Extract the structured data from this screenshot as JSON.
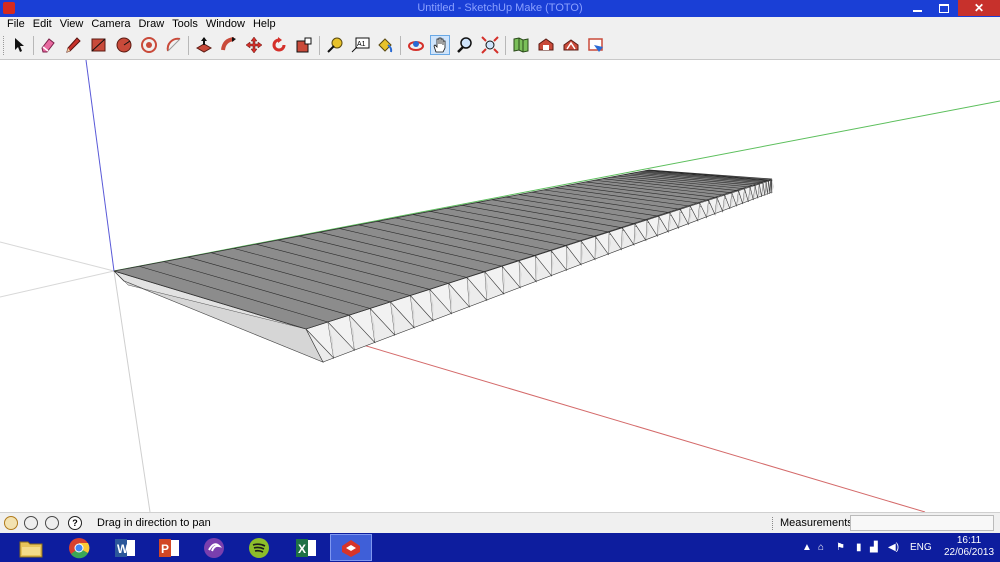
{
  "window": {
    "title": "Untitled - SketchUp Make (TOTO)",
    "close_glyph": "✕"
  },
  "menu": [
    "File",
    "Edit",
    "View",
    "Camera",
    "Draw",
    "Tools",
    "Window",
    "Help"
  ],
  "toolbar": {
    "tools": [
      {
        "name": "select-tool",
        "icon": "arrow-cursor-icon"
      },
      {
        "name": "eraser-tool",
        "icon": "eraser-icon"
      },
      {
        "name": "line-tool",
        "icon": "pencil-icon"
      },
      {
        "name": "rectangle-tool",
        "icon": "rectangle-icon"
      },
      {
        "name": "circle-tool",
        "icon": "circle-icon"
      },
      {
        "name": "polygon-tool",
        "icon": "polygon-icon"
      },
      {
        "name": "arc-tool",
        "icon": "arc-icon"
      },
      {
        "name": "push-pull-tool",
        "icon": "push-pull-icon"
      },
      {
        "name": "follow-me-tool",
        "icon": "follow-me-icon"
      },
      {
        "name": "move-tool",
        "icon": "move-icon"
      },
      {
        "name": "rotate-tool",
        "icon": "rotate-icon"
      },
      {
        "name": "scale-tool",
        "icon": "scale-icon"
      },
      {
        "name": "tape-measure-tool",
        "icon": "tape-measure-icon"
      },
      {
        "name": "text-tool",
        "icon": "text-icon",
        "label": "A1"
      },
      {
        "name": "paint-bucket-tool",
        "icon": "paint-bucket-icon"
      },
      {
        "name": "orbit-tool",
        "icon": "orbit-icon"
      },
      {
        "name": "pan-tool",
        "icon": "hand-icon",
        "active": true
      },
      {
        "name": "zoom-tool",
        "icon": "magnifier-icon"
      },
      {
        "name": "zoom-extents-tool",
        "icon": "zoom-extents-icon"
      },
      {
        "name": "add-location-tool",
        "icon": "map-icon"
      },
      {
        "name": "3d-warehouse-tool",
        "icon": "warehouse-icon"
      },
      {
        "name": "share-model-tool",
        "icon": "share-icon"
      },
      {
        "name": "extension-warehouse-tool",
        "icon": "extension-icon"
      }
    ]
  },
  "status": {
    "message": "Drag in direction to pan",
    "measurements_label": "Measurements",
    "measurements_value": "",
    "help_glyph": "?"
  },
  "taskbar": {
    "apps": [
      {
        "name": "file-explorer",
        "icon": "folder-icon"
      },
      {
        "name": "chrome",
        "icon": "chrome-icon"
      },
      {
        "name": "word",
        "icon": "word-icon",
        "letter": "W"
      },
      {
        "name": "powerpoint",
        "icon": "powerpoint-icon",
        "letter": "P"
      },
      {
        "name": "bittorrent",
        "icon": "bittorrent-icon"
      },
      {
        "name": "spotify",
        "icon": "spotify-icon"
      },
      {
        "name": "excel",
        "icon": "excel-icon",
        "letter": "X"
      },
      {
        "name": "sketchup",
        "icon": "sketchup-icon",
        "active": true
      }
    ],
    "language": "ENG",
    "time": "16:11",
    "date": "22/06/2013"
  },
  "colors": {
    "titlebar": "#1a3fd6",
    "taskbar": "#0d1d9e",
    "axis_red": "#d46a6a",
    "axis_green": "#5cbf5c",
    "axis_blue": "#5a5ad8",
    "roof": "#8c8c8c",
    "side": "#e0e0e0"
  }
}
